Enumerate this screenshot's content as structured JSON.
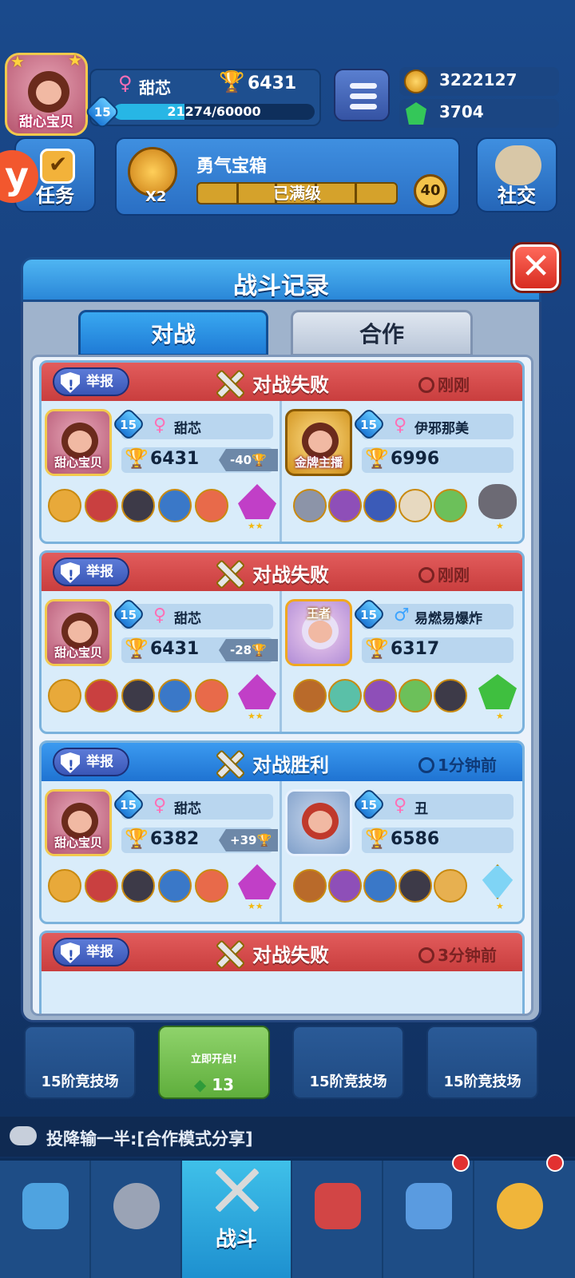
{
  "player": {
    "avatar_tag": "甜心宝贝",
    "name": "甜芯",
    "gender_symbol": "♀",
    "trophies": "6431",
    "level": "15",
    "xp_text": "21274/60000",
    "xp_progress": 0.3546
  },
  "currency": {
    "coins": "3222127",
    "gems": "3704"
  },
  "side_buttons": {
    "tasks_label": "任务",
    "social_label": "社交"
  },
  "chest_bar": {
    "title": "勇气宝箱",
    "multiplier": "X2",
    "progress_text": "已满级",
    "count": "40"
  },
  "modal": {
    "title": "战斗记录",
    "close_glyph": "✕",
    "tabs": [
      {
        "label": "对战",
        "active": true
      },
      {
        "label": "合作",
        "active": false
      }
    ]
  },
  "records": [
    {
      "report_label": "举报",
      "result": "对战失败",
      "outcome": "lose",
      "time": "刚刚",
      "left": {
        "avatar_tag": "甜心宝贝",
        "level": "15",
        "gender": "♀",
        "name": "甜芯",
        "trophies": "6431",
        "delta": "-40"
      },
      "right": {
        "avatar_tag": "金牌主播",
        "level": "15",
        "gender": "♀",
        "name": "伊邪那美",
        "trophies": "6996"
      }
    },
    {
      "report_label": "举报",
      "result": "对战失败",
      "outcome": "lose",
      "time": "刚刚",
      "left": {
        "avatar_tag": "甜心宝贝",
        "level": "15",
        "gender": "♀",
        "name": "甜芯",
        "trophies": "6431",
        "delta": "-28"
      },
      "right": {
        "avatar_tag": "王者",
        "level": "15",
        "gender": "♂",
        "name": "易燃易爆炸",
        "trophies": "6317"
      }
    },
    {
      "report_label": "举报",
      "result": "对战胜利",
      "outcome": "win",
      "time": "1分钟前",
      "left": {
        "avatar_tag": "甜心宝贝",
        "level": "15",
        "gender": "♀",
        "name": "甜芯",
        "trophies": "6382",
        "delta": "+39"
      },
      "right": {
        "avatar_tag": "",
        "level": "15",
        "gender": "♀",
        "name": "丑",
        "trophies": "6586"
      }
    },
    {
      "report_label": "举报",
      "result": "对战失败",
      "outcome": "lose",
      "time": "3分钟前"
    }
  ],
  "card_stars": "★★",
  "card_star_single": "★",
  "chest_slots": [
    {
      "label": "15阶竞技场"
    },
    {
      "label": "立即开启!",
      "count": "13"
    },
    {
      "label": "15阶竞技场"
    },
    {
      "label": "15阶竞技场"
    }
  ],
  "chat": {
    "text": "投降输一半:[合作模式分享]"
  },
  "nav": {
    "battle_label": "战斗"
  },
  "colors": {
    "lose_header": "#d44a4a",
    "win_header": "#2a86e0",
    "accent_gold": "#f0a81f",
    "female": "#ff6fb6",
    "male": "#3da4ff"
  }
}
